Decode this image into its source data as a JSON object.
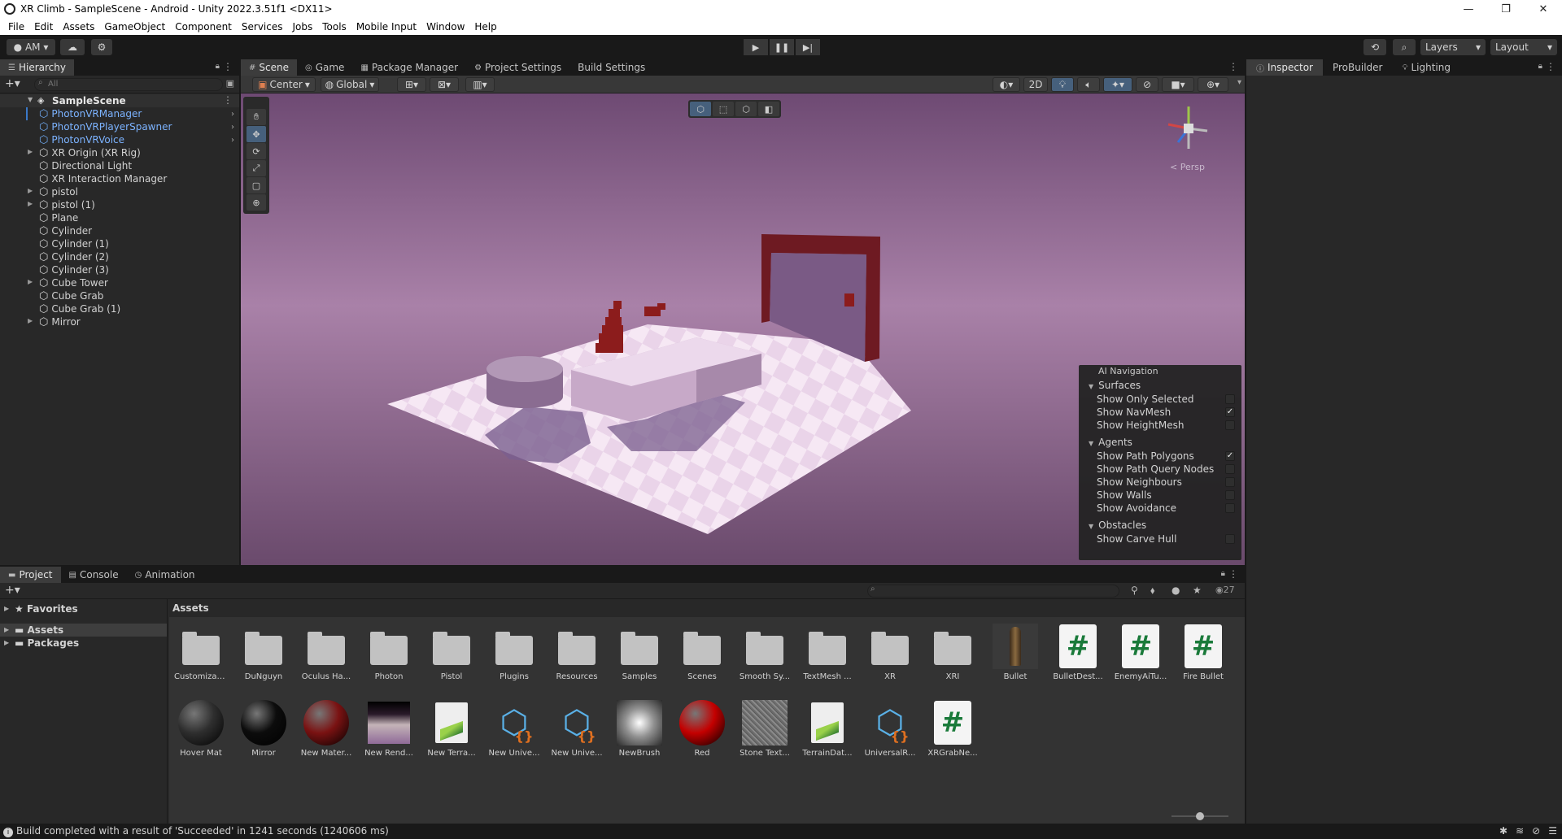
{
  "window": {
    "title": "XR Climb - SampleScene - Android - Unity 2022.3.51f1 <DX11>",
    "controls": [
      "—",
      "❐",
      "✕"
    ]
  },
  "menu": [
    "File",
    "Edit",
    "Assets",
    "GameObject",
    "Component",
    "Services",
    "Jobs",
    "Tools",
    "Mobile Input",
    "Window",
    "Help"
  ],
  "toolbar": {
    "account": "AM",
    "layers": "Layers",
    "layout": "Layout"
  },
  "hierarchy": {
    "tab": "Hierarchy",
    "search_placeholder": "All",
    "scene": "SampleScene",
    "items": [
      {
        "label": "PhotonVRManager",
        "prefab": true,
        "foldable": false
      },
      {
        "label": "PhotonVRPlayerSpawner",
        "prefab": true,
        "foldable": false
      },
      {
        "label": "PhotonVRVoice",
        "prefab": true,
        "foldable": false
      },
      {
        "label": "XR Origin (XR Rig)",
        "prefab": false,
        "foldable": true
      },
      {
        "label": "Directional Light",
        "prefab": false,
        "foldable": false
      },
      {
        "label": "XR Interaction Manager",
        "prefab": false,
        "foldable": false
      },
      {
        "label": "pistol",
        "prefab": false,
        "foldable": true
      },
      {
        "label": "pistol (1)",
        "prefab": false,
        "foldable": true
      },
      {
        "label": "Plane",
        "prefab": false,
        "foldable": false
      },
      {
        "label": "Cylinder",
        "prefab": false,
        "foldable": false
      },
      {
        "label": "Cylinder (1)",
        "prefab": false,
        "foldable": false
      },
      {
        "label": "Cylinder (2)",
        "prefab": false,
        "foldable": false
      },
      {
        "label": "Cylinder (3)",
        "prefab": false,
        "foldable": false
      },
      {
        "label": "Cube Tower",
        "prefab": false,
        "foldable": true
      },
      {
        "label": "Cube Grab",
        "prefab": false,
        "foldable": false
      },
      {
        "label": "Cube Grab (1)",
        "prefab": false,
        "foldable": false
      },
      {
        "label": "Mirror",
        "prefab": false,
        "foldable": true
      }
    ]
  },
  "scene_tabs": [
    "Scene",
    "Game",
    "Package Manager",
    "Project Settings",
    "Build Settings"
  ],
  "scene_toolbar": {
    "pivot": "Center",
    "space": "Global",
    "mode_2d": "2D"
  },
  "gizmo": {
    "projection": "Persp"
  },
  "ai_navigation": {
    "title": "AI Navigation",
    "sections": [
      {
        "name": "Surfaces",
        "options": [
          {
            "label": "Show Only Selected",
            "checked": false
          },
          {
            "label": "Show NavMesh",
            "checked": true
          },
          {
            "label": "Show HeightMesh",
            "checked": false
          }
        ]
      },
      {
        "name": "Agents",
        "options": [
          {
            "label": "Show Path Polygons",
            "checked": true
          },
          {
            "label": "Show Path Query Nodes",
            "checked": false
          },
          {
            "label": "Show Neighbours",
            "checked": false
          },
          {
            "label": "Show Walls",
            "checked": false
          },
          {
            "label": "Show Avoidance",
            "checked": false
          }
        ]
      },
      {
        "name": "Obstacles",
        "options": [
          {
            "label": "Show Carve Hull",
            "checked": false
          }
        ]
      }
    ]
  },
  "inspector_tabs": [
    "Inspector",
    "ProBuilder",
    "Lighting"
  ],
  "bottom_tabs": [
    "Project",
    "Console",
    "Animation"
  ],
  "project": {
    "favorites": "Favorites",
    "tree": [
      "Assets",
      "Packages"
    ],
    "path": "Assets",
    "hidden_count": "27",
    "assets_row1": [
      {
        "label": "Customizab...",
        "kind": "folder"
      },
      {
        "label": "DuNguyn",
        "kind": "folder"
      },
      {
        "label": "Oculus Ha...",
        "kind": "folder"
      },
      {
        "label": "Photon",
        "kind": "folder"
      },
      {
        "label": "Pistol",
        "kind": "folder"
      },
      {
        "label": "Plugins",
        "kind": "folder"
      },
      {
        "label": "Resources",
        "kind": "folder"
      },
      {
        "label": "Samples",
        "kind": "folder"
      },
      {
        "label": "Scenes",
        "kind": "folder"
      },
      {
        "label": "Smooth Sy...",
        "kind": "folder"
      },
      {
        "label": "TextMesh ...",
        "kind": "folder"
      },
      {
        "label": "XR",
        "kind": "folder"
      },
      {
        "label": "XRI",
        "kind": "folder"
      },
      {
        "label": "Bullet",
        "kind": "bullet"
      },
      {
        "label": "BulletDest...",
        "kind": "script"
      },
      {
        "label": "EnemyAiTu...",
        "kind": "script"
      },
      {
        "label": "Fire Bullet",
        "kind": "script"
      }
    ],
    "assets_row2": [
      {
        "label": "Hover Mat",
        "kind": "ball",
        "color": "#2e2e2e"
      },
      {
        "label": "Mirror",
        "kind": "ball",
        "color": "#0c0c0c"
      },
      {
        "label": "New Mater...",
        "kind": "ball",
        "color": "#7a1212"
      },
      {
        "label": "New Rend...",
        "kind": "render"
      },
      {
        "label": "New Terra...",
        "kind": "terrain"
      },
      {
        "label": "New Unive...",
        "kind": "prefabcube"
      },
      {
        "label": "New Unive...",
        "kind": "prefabcube"
      },
      {
        "label": "NewBrush",
        "kind": "brush"
      },
      {
        "label": "Red",
        "kind": "ball",
        "color": "#c40000"
      },
      {
        "label": "Stone Text...",
        "kind": "stone"
      },
      {
        "label": "TerrainDat...",
        "kind": "terrain"
      },
      {
        "label": "UniversalR...",
        "kind": "prefabcube"
      },
      {
        "label": "XRGrabNe...",
        "kind": "script"
      }
    ]
  },
  "status": {
    "message": "Build completed with a result of 'Succeeded' in 1241 seconds (1240606 ms)"
  },
  "colors": {
    "prefab_text": "#7cb3ff",
    "sky_top": "#6e4a73",
    "selected_tool": "#46607c"
  }
}
